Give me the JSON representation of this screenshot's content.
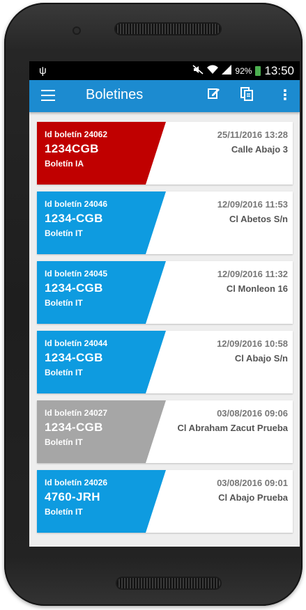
{
  "status_bar": {
    "battery_percent": "92%",
    "time": "13:50",
    "icons": [
      "usb-icon",
      "mute-icon",
      "wifi-icon",
      "signal-icon",
      "battery-icon"
    ]
  },
  "app_bar": {
    "title": "Boletines",
    "icons": [
      "hamburger-menu-icon",
      "edit-note-icon",
      "documents-icon",
      "more-vert-icon"
    ]
  },
  "colors": {
    "app_bar": "#1c8bd0",
    "red": "#c00000",
    "blue": "#0e9be0",
    "gray": "#a6a6a6"
  },
  "boletines": [
    {
      "id": "Id boletín 24062",
      "plate": "1234CGB",
      "type": "Boletín IA",
      "date": "25/11/2016 13:28",
      "street": "Calle Abajo 3",
      "color": "red"
    },
    {
      "id": "Id boletín 24046",
      "plate": "1234-CGB",
      "type": "Boletín IT",
      "date": "12/09/2016 11:53",
      "street": "Cl Abetos S/n",
      "color": "blue"
    },
    {
      "id": "Id boletín 24045",
      "plate": "1234-CGB",
      "type": "Boletín IT",
      "date": "12/09/2016 11:32",
      "street": "Cl Monleon 16",
      "color": "blue"
    },
    {
      "id": "Id boletín 24044",
      "plate": "1234-CGB",
      "type": "Boletín IT",
      "date": "12/09/2016 10:58",
      "street": "Cl Abajo S/n",
      "color": "blue"
    },
    {
      "id": "Id boletín 24027",
      "plate": "1234-CGB",
      "type": "Boletín IT",
      "date": "03/08/2016 09:06",
      "street": "Cl Abraham Zacut Prueba",
      "color": "gray"
    },
    {
      "id": "Id boletín 24026",
      "plate": "4760-JRH",
      "type": "Boletín IT",
      "date": "03/08/2016 09:01",
      "street": "Cl Abajo Prueba",
      "color": "blue"
    }
  ]
}
